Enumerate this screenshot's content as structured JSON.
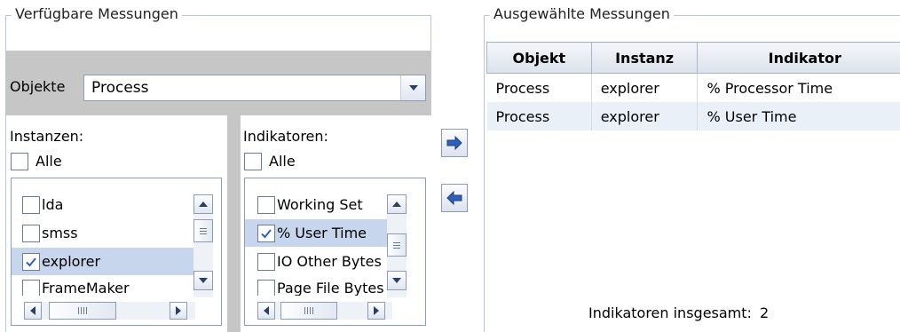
{
  "available": {
    "title": "Verfügbare Messungen",
    "objects_label": "Objekte",
    "objects_value": "Process",
    "instances": {
      "label": "Instanzen:",
      "all_label": "Alle",
      "all_checked": false,
      "items": [
        {
          "label": "lda",
          "checked": false,
          "selected": false
        },
        {
          "label": "smss",
          "checked": false,
          "selected": false
        },
        {
          "label": "explorer",
          "checked": true,
          "selected": true
        },
        {
          "label": "FrameMaker",
          "checked": false,
          "selected": false
        }
      ]
    },
    "indicators": {
      "label": "Indikatoren:",
      "all_label": "Alle",
      "all_checked": false,
      "items": [
        {
          "label": "Working Set",
          "checked": false,
          "selected": false
        },
        {
          "label": "% User Time",
          "checked": true,
          "selected": true
        },
        {
          "label": "IO Other Bytes",
          "checked": false,
          "selected": false
        },
        {
          "label": "Page File Bytes",
          "checked": false,
          "selected": false
        }
      ]
    }
  },
  "selected": {
    "title": "Ausgewählte Messungen",
    "columns": [
      "Objekt",
      "Instanz",
      "Indikator"
    ],
    "rows": [
      [
        "Process",
        "explorer",
        "% Processor Time"
      ],
      [
        "Process",
        "explorer",
        "% User Time"
      ]
    ],
    "total_label": "Indikatoren insgesamt:",
    "total_value": "2"
  },
  "icons": {
    "add": "arrow-right-icon",
    "remove": "arrow-left-icon",
    "dropdown": "chevron-down-icon",
    "check": "checkmark-icon"
  },
  "colors": {
    "accent_arrow": "#2f5fb8",
    "selection": "#c7d6ec",
    "border": "#8f9bb3"
  }
}
